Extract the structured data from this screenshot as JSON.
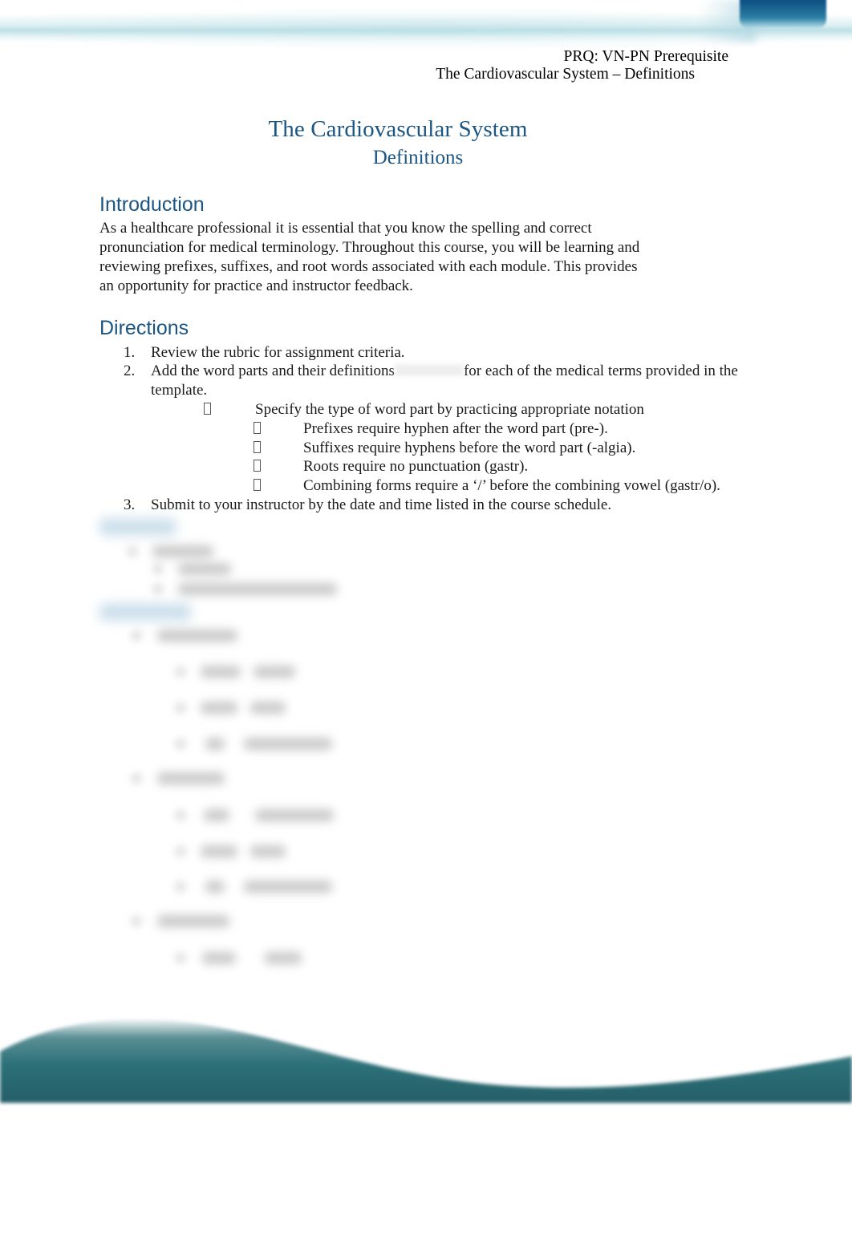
{
  "document": {
    "header_line1": "PRQ: VN-PN Prerequisite",
    "header_line2": "The Cardiovascular System – Definitions",
    "title": "The Cardiovascular System",
    "subtitle": "Definitions"
  },
  "colors": {
    "heading_blue": "#1b5583",
    "corner_block_blue": "#0d4f80",
    "top_band_cyan": "#badfe5",
    "wave_teal": "#2c7078",
    "body_text": "#1a1a1a"
  },
  "sections": {
    "introduction": {
      "heading": "Introduction",
      "paragraph": "As a healthcare professional it is essential that you know the spelling and correct pronunciation for medical terminology. Throughout this course, you will be learning and reviewing prefixes, suffixes, and root words associated with each module. This provides an opportunity for practice and instructor feedback."
    },
    "directions": {
      "heading": "Directions",
      "items": [
        {
          "number": "1.",
          "text": "Review the rubric for assignment criteria."
        },
        {
          "number": "2.",
          "text_before_redaction": "Add the word parts and their definitions",
          "text_after_redaction": "for each of the medical terms provided in the template.",
          "has_redaction": true
        },
        {
          "number": "3.",
          "text": "Submit to your instructor by the date and time listed in the course schedule."
        }
      ],
      "sub_bullet": "Specify the type of word part by practicing appropriate notation",
      "sub_sub_bullets": [
        "Prefixes require hyphen after the word part (pre-).",
        "Suffixes require hyphens before the word part (-algia).",
        "Roots require no punctuation (gastr).",
        "Combining forms require a ‘/’ before the combining vowel (gastr/o)."
      ]
    },
    "redacted_blocks": {
      "note": "Two further headings and their lists are blurred/illegible in the source",
      "count": 2
    }
  }
}
